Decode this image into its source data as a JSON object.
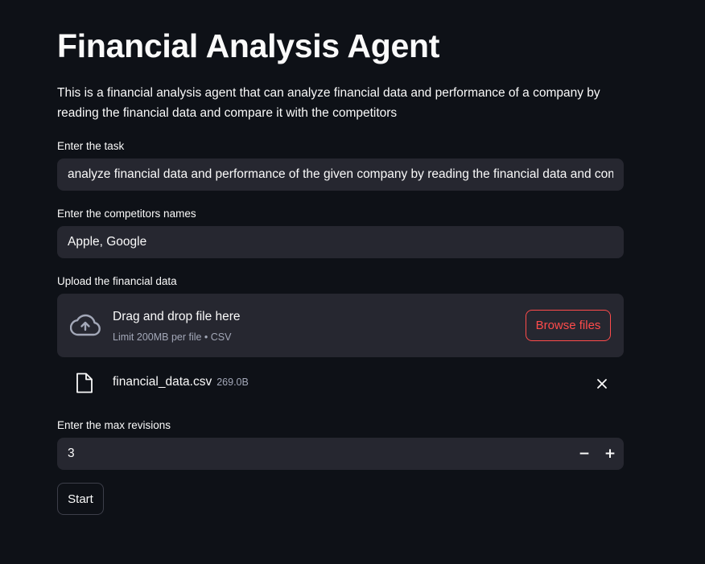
{
  "page": {
    "title": "Financial Analysis Agent",
    "description": "This is a financial analysis agent that can analyze financial data and performance of a company by reading the financial data and compare it with the competitors"
  },
  "task": {
    "label": "Enter the task",
    "value": "analyze financial data and performance of the given company by reading the financial data and compare it with the competitors"
  },
  "competitors": {
    "label": "Enter the competitors names",
    "value": "Apple, Google"
  },
  "upload": {
    "label": "Upload the financial data",
    "dropzone_title": "Drag and drop file here",
    "dropzone_limit": "Limit 200MB per file • CSV",
    "browse_label": "Browse files",
    "file": {
      "name": "financial_data.csv",
      "size": "269.0B"
    }
  },
  "max_revisions": {
    "label": "Enter the max revisions",
    "value": "3",
    "decrement": "−",
    "increment": "+"
  },
  "actions": {
    "start_label": "Start"
  },
  "colors": {
    "background": "#0e1117",
    "input_bg": "#262730",
    "accent": "#ff4b4b",
    "text": "#fafafa",
    "muted_text": "#a3a8b8"
  },
  "icons": {
    "upload": "cloud-upload-icon",
    "file": "file-icon",
    "remove": "close-icon"
  }
}
